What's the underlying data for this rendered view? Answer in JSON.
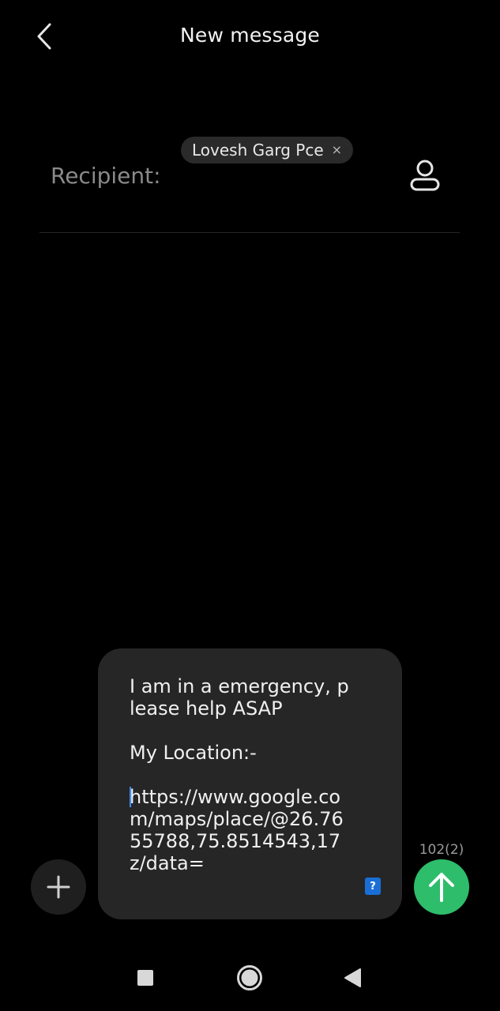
{
  "header": {
    "title": "New message",
    "back_icon": "chevron-left-icon"
  },
  "recipient": {
    "label": "Recipient:",
    "chip_name": "Lovesh Garg Pce",
    "chip_remove": "×",
    "contact_icon": "person-icon"
  },
  "composer": {
    "message_before_caret": "I am in a emergency, please help ASAP\n\nMy Location:-\n\n",
    "message_after_caret": "https://www.google.com/maps/place/@26.7655788,75.8514543,17z/data=",
    "sim_badge": "?",
    "char_count": "102(2)",
    "add_icon": "plus-icon",
    "send_icon": "arrow-up-icon",
    "send_color": "#2ebd6b"
  },
  "navbar": {
    "recent_icon": "square-icon",
    "home_icon": "circle-icon",
    "back_icon": "triangle-back-icon"
  }
}
